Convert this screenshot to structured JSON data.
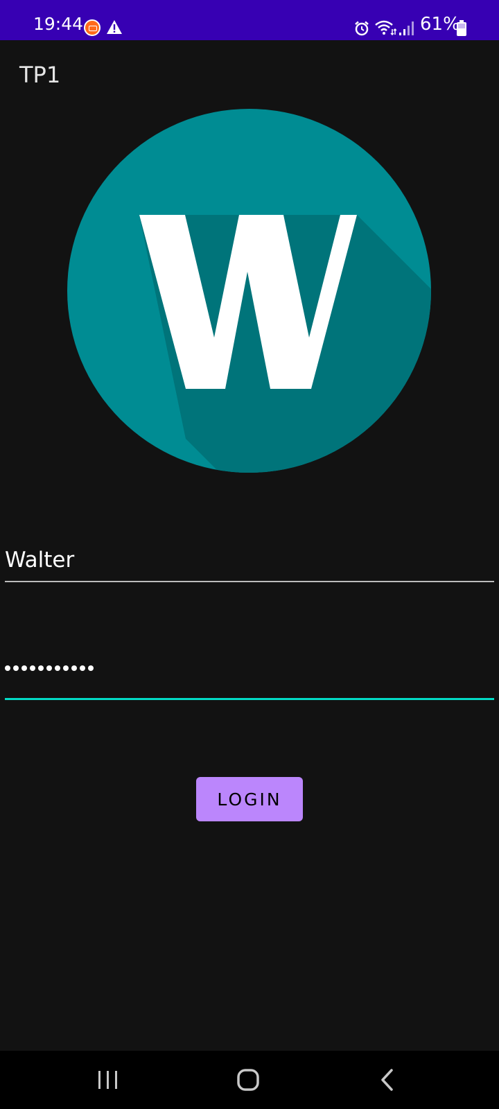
{
  "status_bar": {
    "time": "19:44",
    "battery": "61%",
    "icons": [
      "app-notification-icon",
      "warning-icon",
      "alarm-icon",
      "wifi-icon",
      "signal-icon",
      "battery-icon"
    ]
  },
  "app_bar": {
    "title": "TP1"
  },
  "logo": {
    "letter": "W",
    "circle_color": "#008c93",
    "shadow_color": "#00747a",
    "letter_color": "#ffffff"
  },
  "form": {
    "username_value": "Walter",
    "password_length": 11,
    "active_underline_color": "#03dac5",
    "login_label": "LOGIN",
    "button_color": "#bb86fc"
  },
  "colors": {
    "status_bar": "#3700b3",
    "background": "#121212"
  },
  "nav_bar": {
    "icons": [
      "recents-icon",
      "home-icon",
      "back-icon"
    ]
  }
}
